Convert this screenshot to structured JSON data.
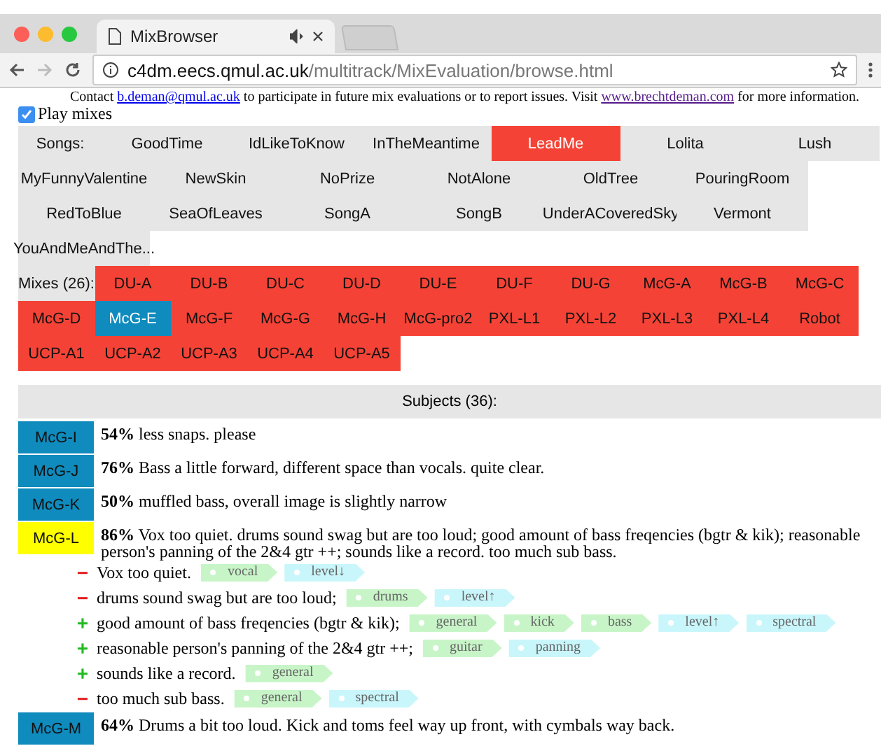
{
  "browser": {
    "tab_title": "MixBrowser",
    "url_host": "c4dm.eecs.qmul.ac.uk",
    "url_path": "/multitrack/MixEvaluation/browse.html"
  },
  "contact": {
    "before": "Contact ",
    "email": "b.deman@qmul.ac.uk",
    "middle": " to participate in future mix evaluations or to report issues. Visit ",
    "site": "www.brechtdeman.com",
    "after": " for more information."
  },
  "play_mixes": {
    "label": "Play mixes",
    "checked": true
  },
  "songs": {
    "label": "Songs:",
    "items": [
      {
        "name": "GoodTime",
        "selected": false
      },
      {
        "name": "IdLikeToKnow",
        "selected": false
      },
      {
        "name": "InTheMeantime",
        "selected": false
      },
      {
        "name": "LeadMe",
        "selected": true
      },
      {
        "name": "Lolita",
        "selected": false
      },
      {
        "name": "Lush",
        "selected": false
      },
      {
        "name": "MyFunnyValentine",
        "selected": false
      },
      {
        "name": "NewSkin",
        "selected": false
      },
      {
        "name": "NoPrize",
        "selected": false
      },
      {
        "name": "NotAlone",
        "selected": false
      },
      {
        "name": "OldTree",
        "selected": false
      },
      {
        "name": "PouringRoom",
        "selected": false
      },
      {
        "name": "RedToBlue",
        "selected": false
      },
      {
        "name": "SeaOfLeaves",
        "selected": false
      },
      {
        "name": "SongA",
        "selected": false
      },
      {
        "name": "SongB",
        "selected": false
      },
      {
        "name": "UnderACoveredSky",
        "selected": false
      },
      {
        "name": "Vermont",
        "selected": false
      },
      {
        "name": "YouAndMeAndThe...",
        "selected": false
      }
    ]
  },
  "mixes": {
    "label": "Mixes (26):",
    "items": [
      {
        "name": "DU-A",
        "selected": false
      },
      {
        "name": "DU-B",
        "selected": false
      },
      {
        "name": "DU-C",
        "selected": false
      },
      {
        "name": "DU-D",
        "selected": false
      },
      {
        "name": "DU-E",
        "selected": false
      },
      {
        "name": "DU-F",
        "selected": false
      },
      {
        "name": "DU-G",
        "selected": false
      },
      {
        "name": "McG-A",
        "selected": false
      },
      {
        "name": "McG-B",
        "selected": false
      },
      {
        "name": "McG-C",
        "selected": false
      },
      {
        "name": "McG-D",
        "selected": false
      },
      {
        "name": "McG-E",
        "selected": true
      },
      {
        "name": "McG-F",
        "selected": false
      },
      {
        "name": "McG-G",
        "selected": false
      },
      {
        "name": "McG-H",
        "selected": false
      },
      {
        "name": "McG-pro2",
        "selected": false
      },
      {
        "name": "PXL-L1",
        "selected": false
      },
      {
        "name": "PXL-L2",
        "selected": false
      },
      {
        "name": "PXL-L3",
        "selected": false
      },
      {
        "name": "PXL-L4",
        "selected": false
      },
      {
        "name": "Robot",
        "selected": false
      },
      {
        "name": "UCP-A1",
        "selected": false
      },
      {
        "name": "UCP-A2",
        "selected": false
      },
      {
        "name": "UCP-A3",
        "selected": false
      },
      {
        "name": "UCP-A4",
        "selected": false
      },
      {
        "name": "UCP-A5",
        "selected": false
      }
    ]
  },
  "subjects": {
    "title": "Subjects (36):",
    "items": [
      {
        "name": "McG-I",
        "color": "#0f8bbd",
        "score": "54%",
        "text": "less snaps. please"
      },
      {
        "name": "McG-J",
        "color": "#0f8bbd",
        "score": "76%",
        "text": "Bass a little forward, different space than vocals. quite clear."
      },
      {
        "name": "McG-K",
        "color": "#0f8bbd",
        "score": "50%",
        "text": "muffled bass, overall image is slightly narrow"
      },
      {
        "name": "McG-L",
        "color": "#ffff00",
        "score": "86%",
        "text": "Vox too quiet. drums sound swag but are too loud; good amount of bass freqencies (bgtr & kik); reasonable person's panning of the 2&4 gtr ++; sounds like a record. too much sub bass.",
        "comments": [
          {
            "kind": "negative",
            "sign": "−",
            "text": "Vox too quiet.",
            "tags": [
              {
                "kind": "instrument",
                "label": "vocal"
              },
              {
                "kind": "attribute",
                "label": "level↓"
              }
            ]
          },
          {
            "kind": "negative",
            "sign": "−",
            "text": "drums sound swag but are too loud;",
            "tags": [
              {
                "kind": "instrument",
                "label": "drums"
              },
              {
                "kind": "attribute",
                "label": "level↑"
              }
            ]
          },
          {
            "kind": "positive",
            "sign": "+",
            "text": "good amount of bass freqencies (bgtr & kik);",
            "tags": [
              {
                "kind": "instrument",
                "label": "general"
              },
              {
                "kind": "instrument",
                "label": "kick"
              },
              {
                "kind": "instrument",
                "label": "bass"
              },
              {
                "kind": "attribute",
                "label": "level↑"
              },
              {
                "kind": "attribute",
                "label": "spectral"
              }
            ]
          },
          {
            "kind": "positive",
            "sign": "+",
            "text": "reasonable person's panning of the 2&4 gtr ++;",
            "tags": [
              {
                "kind": "instrument",
                "label": "guitar"
              },
              {
                "kind": "attribute",
                "label": "panning"
              }
            ]
          },
          {
            "kind": "positive",
            "sign": "+",
            "text": "sounds like a record.",
            "tags": [
              {
                "kind": "instrument",
                "label": "general"
              }
            ]
          },
          {
            "kind": "negative",
            "sign": "−",
            "text": "too much sub bass.",
            "tags": [
              {
                "kind": "instrument",
                "label": "general"
              },
              {
                "kind": "attribute",
                "label": "spectral"
              }
            ]
          }
        ]
      },
      {
        "name": "McG-M",
        "color": "#0f8bbd",
        "score": "64%",
        "text": "Drums a bit too loud. Kick and toms feel way up front, with cymbals way back."
      }
    ]
  }
}
